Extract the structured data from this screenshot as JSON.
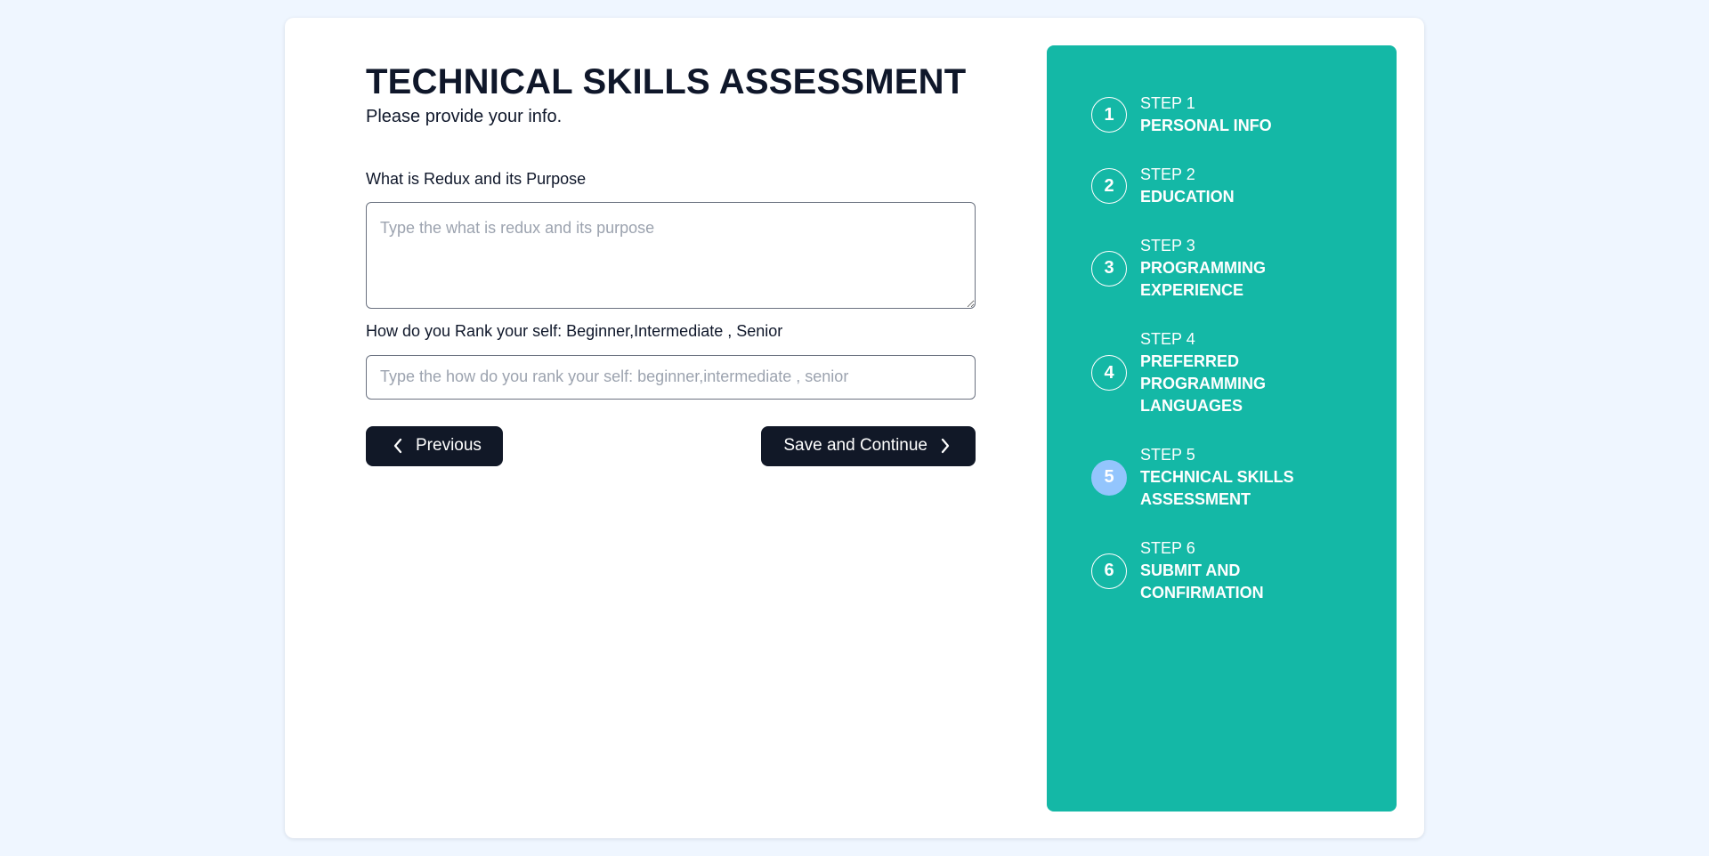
{
  "page": {
    "title": "TECHNICAL SKILLS ASSESSMENT",
    "subtitle": "Please provide your info."
  },
  "form": {
    "question1": {
      "label": "What is Redux and its Purpose",
      "value": "",
      "placeholder": "Type the what is redux and its purpose"
    },
    "question2": {
      "label": "How do you Rank your self: Beginner,Intermediate , Senior",
      "value": "",
      "placeholder": "Type the how do you rank your self: beginner,intermediate , senior"
    },
    "previous_label": "Previous",
    "next_label": "Save and Continue"
  },
  "steps": {
    "active_index": 5,
    "items": [
      {
        "number": "1",
        "step_label": "STEP 1",
        "name": "PERSONAL INFO"
      },
      {
        "number": "2",
        "step_label": "STEP 2",
        "name": "EDUCATION"
      },
      {
        "number": "3",
        "step_label": "STEP 3",
        "name": "PROGRAMMING EXPERIENCE"
      },
      {
        "number": "4",
        "step_label": "STEP 4",
        "name": "PREFERRED PROGRAMMING LANGUAGES"
      },
      {
        "number": "5",
        "step_label": "STEP 5",
        "name": "TECHNICAL SKILLS ASSESSMENT"
      },
      {
        "number": "6",
        "step_label": "STEP 6",
        "name": "SUBMIT AND CONFIRMATION"
      }
    ]
  },
  "colors": {
    "page_background": "#eff6ff",
    "panel_accent": "#14b8a6",
    "active_step": "#93c5fd",
    "button_background": "#111827"
  },
  "icons": {
    "previous": "chevron-left-icon",
    "next": "chevron-right-icon"
  }
}
